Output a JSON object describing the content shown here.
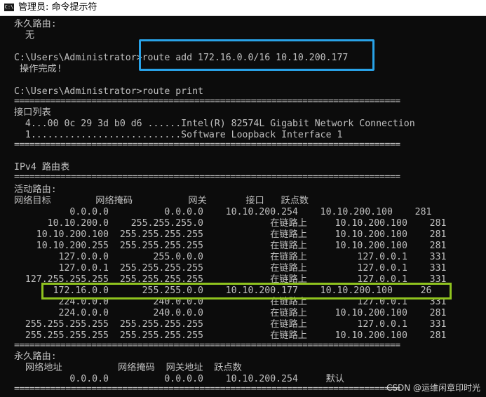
{
  "window": {
    "title": "管理员: 命令提示符",
    "icon": "cmd-icon"
  },
  "terminal": {
    "lines": [
      "永久路由:",
      "  无",
      "",
      "C:\\Users\\Administrator>route add 172.16.0.0/16 10.10.200.177",
      " 操作完成!",
      "",
      "C:\\Users\\Administrator>route print",
      "===========================================================================",
      "接口列表",
      "  4...00 0c 29 3d b0 d6 ......Intel(R) 82574L Gigabit Network Connection",
      "  1...........................Software Loopback Interface 1",
      "===========================================================================",
      "",
      "IPv4 路由表",
      "===========================================================================",
      "活动路由:",
      "网络目标        网络掩码          网关       接口   跃点数",
      "          0.0.0.0          0.0.0.0    10.10.200.254    10.10.200.100    281",
      "      10.10.200.0    255.255.255.0            在链路上     10.10.200.100    281",
      "    10.10.200.100  255.255.255.255            在链路上     10.10.200.100    281",
      "    10.10.200.255  255.255.255.255            在链路上     10.10.200.100    281",
      "        127.0.0.0        255.0.0.0            在链路上         127.0.0.1    331",
      "        127.0.0.1  255.255.255.255            在链路上         127.0.0.1    331",
      "  127.255.255.255  255.255.255.255            在链路上         127.0.0.1    331",
      "       172.16.0.0      255.255.0.0    10.10.200.177    10.10.200.100     26",
      "        224.0.0.0        240.0.0.0            在链路上         127.0.0.1    331",
      "        224.0.0.0        240.0.0.0            在链路上     10.10.200.100    281",
      "  255.255.255.255  255.255.255.255            在链路上         127.0.0.1    331",
      "  255.255.255.255  255.255.255.255            在链路上     10.10.200.100    281",
      "===========================================================================",
      "永久路由:",
      "  网络地址          网络掩码  网关地址  跃点数",
      "          0.0.0.0          0.0.0.0    10.10.200.254     默认",
      "==========================================================================="
    ]
  },
  "watermark": "CSDN @运维闲章印时光",
  "colors": {
    "background": "#0c0c0c",
    "text": "#c0c0c0",
    "highlight_command": "#29a3e8",
    "highlight_route": "#8fc31f"
  }
}
